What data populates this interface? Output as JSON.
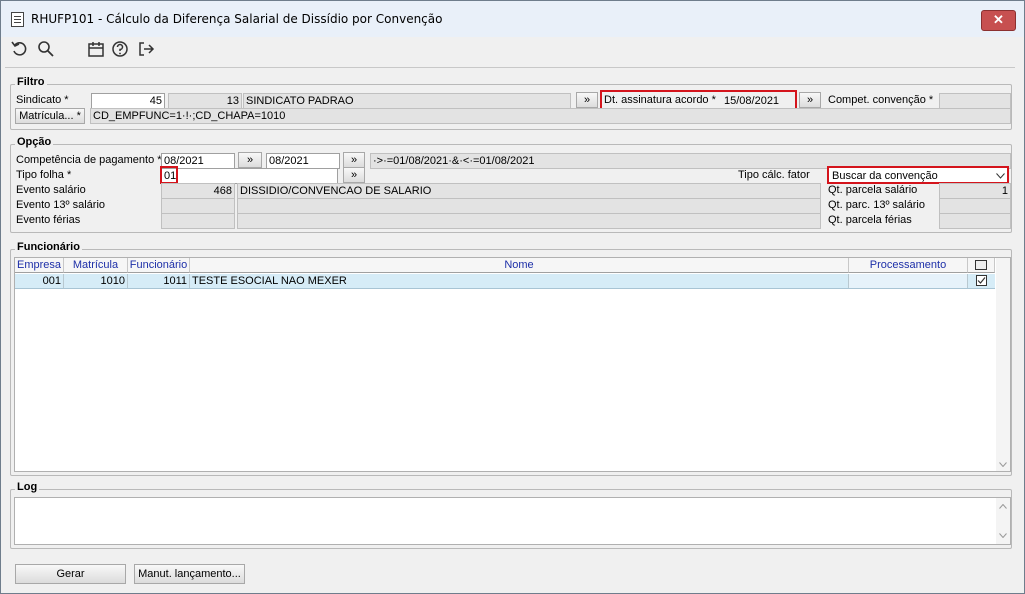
{
  "window": {
    "title": "RHUFP101 - Cálculo da Diferença Salarial de Dissídio por Convenção",
    "close": "✕"
  },
  "toolbar": {
    "icons": [
      "undo-icon",
      "search-icon",
      "calendar-icon",
      "help-icon",
      "exit-icon"
    ]
  },
  "filtro": {
    "title": "Filtro",
    "sindicato_label": "Sindicato *",
    "sindicato_code": "45",
    "sindicato_code2": "13",
    "sindicato_name": "SINDICATO PADRAO",
    "nav": "»",
    "dt_assinatura_label": "Dt. assinatura acordo *",
    "dt_assinatura_value": "15/08/2021",
    "compet_label": "Compet. convenção *",
    "compet_value": "",
    "matricula_button": "Matrícula... *",
    "matricula_filter": "CD_EMPFUNC=1·!·;CD_CHAPA=1010"
  },
  "opcao": {
    "title": "Opção",
    "competencia_label": "Competência de pagamento *",
    "competencia_from": "08/2021",
    "competencia_to": "08/2021",
    "competencia_expr": "·>·=01/08/2021·&·<·=01/08/2021",
    "tipo_folha_label": "Tipo folha *",
    "tipo_folha_value": "01",
    "tipo_calc_label": "Tipo cálc. fator",
    "tipo_calc_value": "Buscar da convenção",
    "evento_salario_label": "Evento salário",
    "evento_salario_code": "468",
    "evento_salario_desc": "DISSIDIO/CONVENCAO DE SALARIO",
    "evento_13_label": "Evento 13º salário",
    "evento_ferias_label": "Evento férias",
    "qt_parcela_label": "Qt. parcela salário",
    "qt_parcela_value": "1",
    "qt_13_label": "Qt. parc. 13º salário",
    "qt_ferias_label": "Qt. parcela férias"
  },
  "funcionario": {
    "title": "Funcionário",
    "columns": [
      "Empresa",
      "Matrícula",
      "Funcionário",
      "Nome",
      "Processamento"
    ],
    "rows": [
      {
        "empresa": "001",
        "matricula": "1010",
        "funcionario": "1011",
        "nome": "TESTE ESOCIAL NAO MEXER",
        "processamento": "",
        "checked": true
      }
    ]
  },
  "log": {
    "title": "Log"
  },
  "footer": {
    "gerar": "Gerar",
    "manut": "Manut. lançamento..."
  },
  "colors": {
    "highlight": "#d4141c",
    "header_text": "#1d2fa8",
    "selected_row": "#d6ecf7"
  }
}
